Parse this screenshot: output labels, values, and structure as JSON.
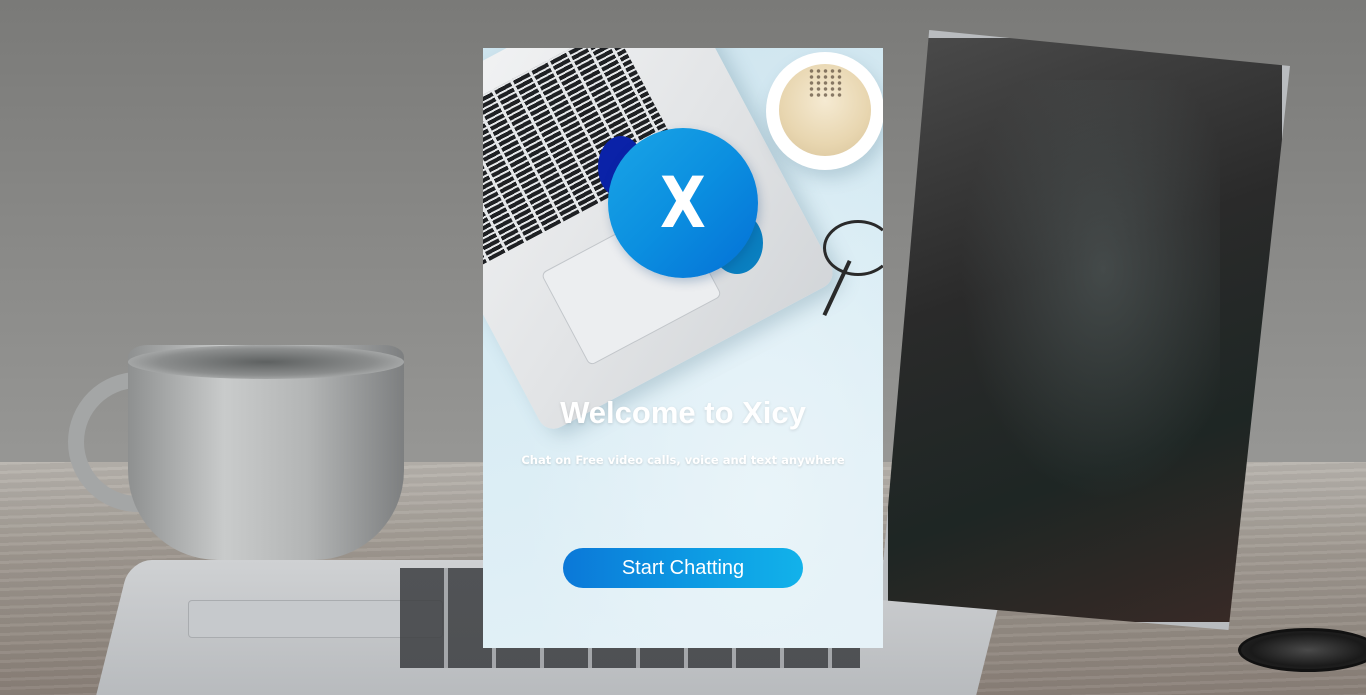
{
  "welcome": {
    "logo_letter": "X",
    "title": "Welcome to Xicy",
    "subtitle": "Chat on Free video calls, voice and text anywhere",
    "start_button_label": "Start Chatting"
  },
  "colors": {
    "brand_blue": "#0b8fe0",
    "brand_dark": "#0a22a8",
    "button_gradient_start": "#0b78d8",
    "button_gradient_end": "#12b2ea"
  },
  "icons": {
    "logo": "xicy-logo-icon"
  }
}
